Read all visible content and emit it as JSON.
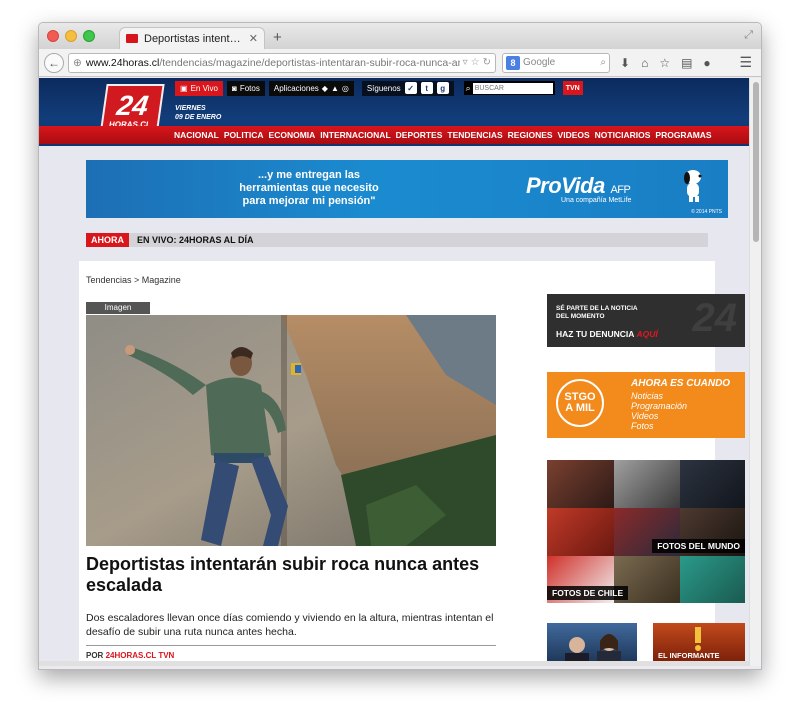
{
  "browser": {
    "tab_title": "Deportistas intentarán sub...",
    "url_host": "www.24horas.cl",
    "url_path": "/tendencias/magazine/deportistas-intentaran-subir-roca-nunca-antes-escalada-1",
    "search_placeholder": "Google",
    "search_engine_badge": "8"
  },
  "site": {
    "logo_number": "24",
    "logo_sub": "HORAS.CL",
    "topnav": {
      "en_vivo": "En Vivo",
      "fotos": "Fotos",
      "aplicaciones": "Aplicaciones",
      "siguenos": "Síguenos",
      "search_placeholder": "BUSCAR",
      "tvn": "TVN"
    },
    "date": {
      "weekday": "VIERNES",
      "day": "09 DE ENERO"
    },
    "nav": [
      "NACIONAL",
      "POLITICA",
      "ECONOMIA",
      "INTERNACIONAL",
      "DEPORTES",
      "TENDENCIAS",
      "REGIONES",
      "VIDEOS",
      "NOTICIARIOS",
      "PROGRAMAS"
    ]
  },
  "ad": {
    "line1": "...y me entregan las",
    "line2": "herramientas que necesito",
    "line3": "para mejorar mi pensión\"",
    "brand": "ProVida",
    "brand_suffix": "AFP",
    "sub": "Una compañía MetLife",
    "copyright": "© 2014 PNTS"
  },
  "ticker": {
    "label": "AHORA",
    "text": "EN VIVO: 24HORAS AL DÍA"
  },
  "article": {
    "breadcrumb": "Tendencias > Magazine",
    "image_tab": "Imagen",
    "headline": "Deportistas intentarán subir roca nunca antes escalada",
    "summary": "Dos escaladores llevan once días comiendo y viviendo en la altura, mientras intentan el desafío de subir una ruta nunca antes hecha.",
    "byline_prefix": "POR",
    "byline_source": "24HORAS.CL TVN"
  },
  "sidebar": {
    "denuncia": {
      "line1": "SÉ PARTE DE LA NOTICIA",
      "line2": "DEL MOMENTO",
      "cta": "HAZ TU DENUNCIA",
      "aqui": "AQUÍ",
      "bg_number": "24"
    },
    "stgo": {
      "logo_top": "STGO",
      "logo_bottom": "A MIL",
      "headline": "AHORA ES CUANDO",
      "items": [
        "Noticias",
        "Programación",
        "Videos",
        "Fotos"
      ]
    },
    "mosaic": {
      "caption_world": "FOTOS DEL MUNDO",
      "caption_chile": "FOTOS DE CHILE"
    },
    "informante": "EL INFORMANTE"
  }
}
